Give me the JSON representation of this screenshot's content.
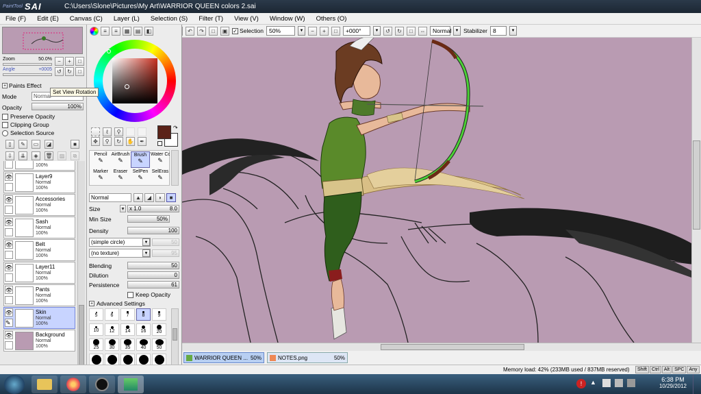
{
  "app": {
    "logo_small": "PaintTool",
    "logo_big": "SAI",
    "title": "C:\\Users\\Slone\\Pictures\\My Art\\WARRIOR QUEEN colors 2.sai"
  },
  "menu": [
    "File (F)",
    "Edit (E)",
    "Canvas (C)",
    "Layer (L)",
    "Selection (S)",
    "Filter (T)",
    "View (V)",
    "Window (W)",
    "Others (O)"
  ],
  "toolbar": {
    "selection_label": "Selection",
    "selection_checked": true,
    "zoom_value": "50%",
    "angle_value": "+000°",
    "blend_value": "Normal",
    "stabilizer_label": "Stabilizer",
    "stabilizer_value": "8"
  },
  "navigator": {
    "zoom_label": "Zoom",
    "zoom_value": "50.0%",
    "angle_label": "Angle",
    "angle_value": "+0005",
    "tooltip": "Set View Rotation"
  },
  "layer_props": {
    "paints_effect": "Paints Effect",
    "mode_label": "Mode",
    "mode_value": "Normal",
    "opacity_label": "Opacity",
    "opacity_value": "100%",
    "opacity_fraction": 1.0,
    "preserve_opacity": "Preserve Opacity",
    "clipping_group": "Clipping Group",
    "selection_source": "Selection Source"
  },
  "layers": [
    {
      "name": "Normal",
      "mode": "",
      "opacity": "100%",
      "partial": true
    },
    {
      "name": "Layer9",
      "mode": "Normal",
      "opacity": "100%"
    },
    {
      "name": "Accessories",
      "mode": "Normal",
      "opacity": "100%"
    },
    {
      "name": "Sash",
      "mode": "Normal",
      "opacity": "100%"
    },
    {
      "name": "Belt",
      "mode": "Normal",
      "opacity": "100%"
    },
    {
      "name": "Layer11",
      "mode": "Normal",
      "opacity": "100%"
    },
    {
      "name": "Pants",
      "mode": "Normal",
      "opacity": "100%"
    },
    {
      "name": "Skin",
      "mode": "Normal",
      "opacity": "100%",
      "selected": true
    },
    {
      "name": "Background",
      "mode": "Normal",
      "opacity": "100%"
    }
  ],
  "color": {
    "primary": "#5a2218",
    "secondary": "#ffffff"
  },
  "brushes": [
    {
      "name": "Pencil",
      "icon": "pencil-icon"
    },
    {
      "name": "AirBrush",
      "icon": "airbrush-icon"
    },
    {
      "name": "Brush",
      "icon": "brush-icon",
      "selected": true
    },
    {
      "name": "Water Color",
      "icon": "watercolor-icon"
    },
    {
      "name": "Marker",
      "icon": "marker-icon"
    },
    {
      "name": "Eraser",
      "icon": "eraser-icon"
    },
    {
      "name": "SelPen",
      "icon": "selpen-icon"
    },
    {
      "name": "SelEras",
      "icon": "seleras-icon"
    }
  ],
  "brush_settings": {
    "mode": "Normal",
    "size_label": "Size",
    "size_mult": "x 1.0",
    "size_value": "8.0",
    "min_size_label": "Min Size",
    "min_size_value": "50%",
    "density_label": "Density",
    "density_value": "100",
    "shape": "(simple circle)",
    "shape_value": "50",
    "texture": "(no texture)",
    "texture_value": "95",
    "blending_label": "Blending",
    "blending_value": "50",
    "dilution_label": "Dilution",
    "dilution_value": "0",
    "persistence_label": "Persistence",
    "persistence_value": "61",
    "keep_opacity": "Keep Opacity",
    "advanced": "Advanced Settings"
  },
  "brush_sizes": [
    "5",
    "6",
    "7",
    "8",
    "9",
    "10",
    "12",
    "14",
    "16",
    "20",
    "25",
    "30",
    "35",
    "40",
    "50"
  ],
  "selected_brush_size": "8",
  "tabs": [
    {
      "name": "WARRIOR QUEEN ...",
      "zoom": "50%",
      "active": true
    },
    {
      "name": "NOTES.png",
      "zoom": "50%",
      "active": false
    }
  ],
  "status": {
    "memory": "Memory load: 42% (233MB used / 837MB reserved)",
    "keys": [
      "Shift",
      "Ctrl",
      "Alt",
      "SPC",
      "Any"
    ]
  },
  "taskbar": {
    "time": "6:38 PM",
    "date": "10/29/2012"
  }
}
